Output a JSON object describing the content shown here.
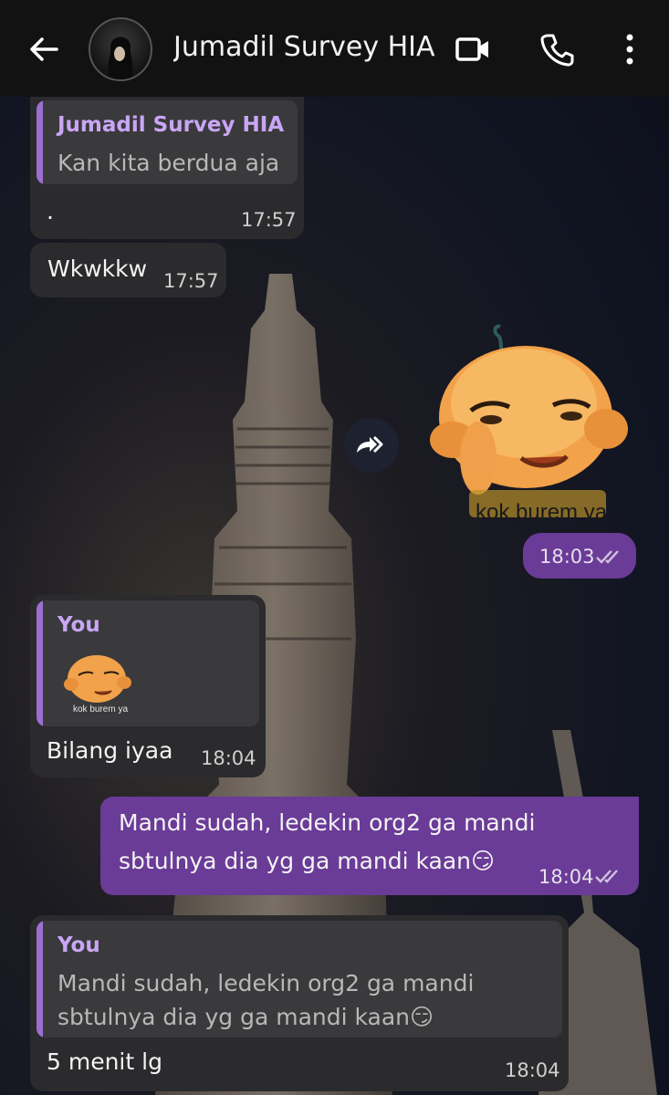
{
  "header": {
    "title": "Jumadil Survey HIA",
    "back_icon": "arrow-left-icon",
    "video_icon": "video-call-icon",
    "call_icon": "phone-icon",
    "menu_icon": "more-vert-icon"
  },
  "messages": [
    {
      "quote_name": "Jumadil Survey HIA",
      "quote_text": "Kan kita berdua aja",
      "text": "·",
      "time": "17:57"
    },
    {
      "text": "Wkwkkw",
      "time": "17:57"
    },
    {
      "sticker_caption": "kok burem ya",
      "time": "18:03",
      "forward_icon": "forward-icon"
    },
    {
      "quote_name": "You",
      "quote_sticker_caption": "kok burem ya",
      "text": "Bilang iyaa",
      "time": "18:04"
    },
    {
      "text_line1": "Mandi sudah, ledekin org2 ga mandi",
      "text_line2": "sbtulnya dia yg ga mandi kaan😏",
      "time": "18:04"
    },
    {
      "quote_name": "You",
      "quote_line1": "Mandi sudah, ledekin org2 ga mandi",
      "quote_line2": "sbtulnya dia yg ga mandi kaan😏",
      "text": "5 menit lg",
      "time": "18:04"
    }
  ],
  "colors": {
    "outgoing_bubble": "#6a3b97",
    "incoming_bubble": "#2b2b2d",
    "quote_accent": "#9b6fd1"
  }
}
